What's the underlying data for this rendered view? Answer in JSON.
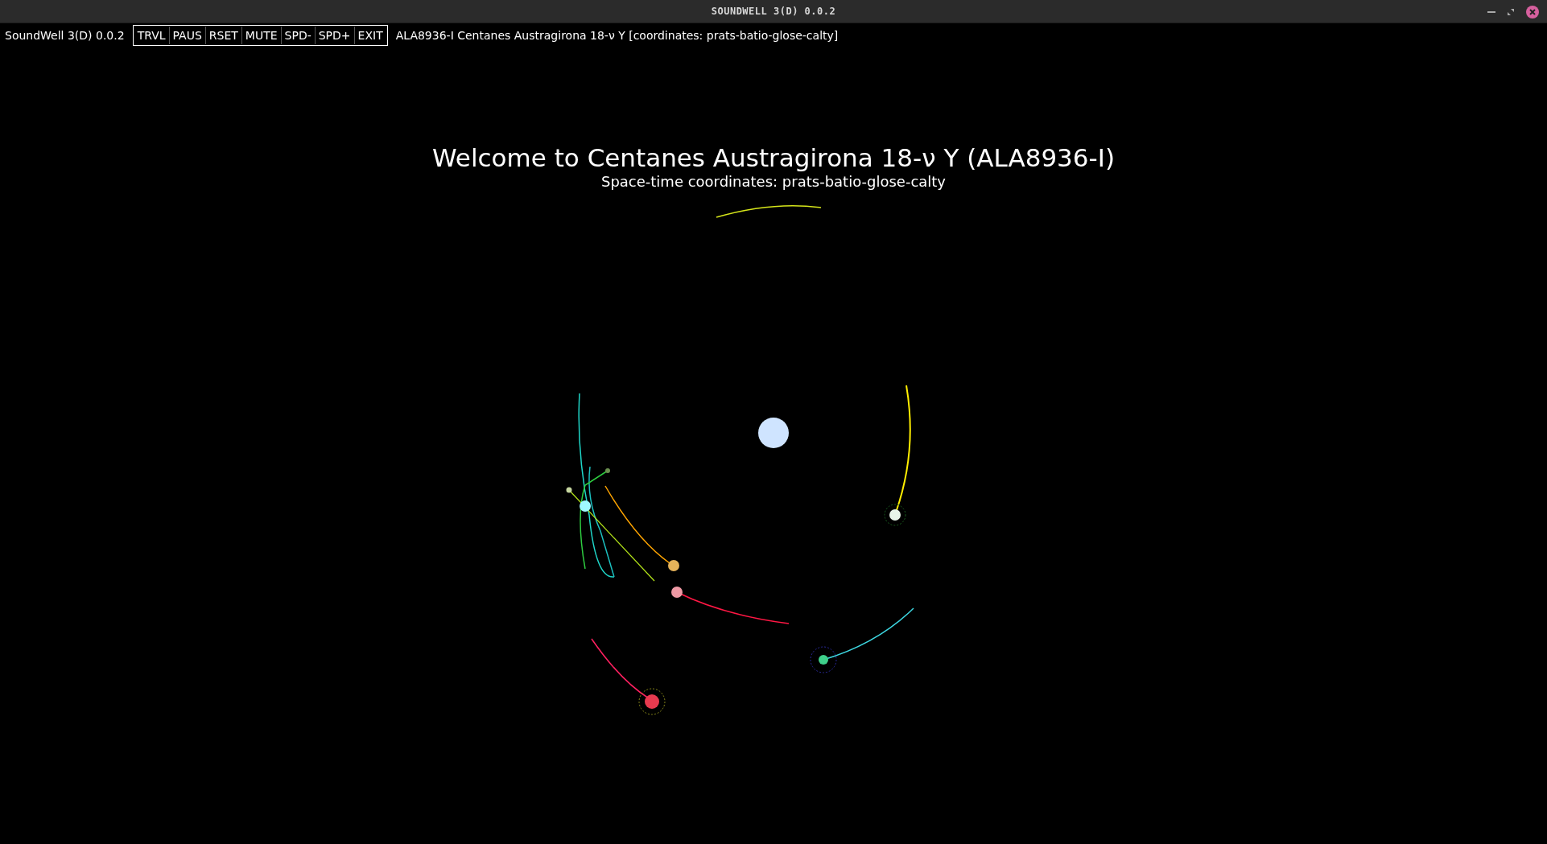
{
  "window": {
    "title": "SOUNDWELL 3(D) 0.0.2"
  },
  "app_name": "SoundWell 3(D) 0.0.2",
  "toolbar": [
    "TRVL",
    "PAUS",
    "RSET",
    "MUTE",
    "SPD-",
    "SPD+",
    "EXIT"
  ],
  "location": "ALA8936-I Centanes Austragirona 18-ν Y [coordinates: prats-batio-glose-calty]",
  "welcome": {
    "title": "Welcome to Centanes Austragirona 18-ν Y (ALA8936-I)",
    "subtitle": "Space-time coordinates: prats-batio-glose-calty"
  }
}
